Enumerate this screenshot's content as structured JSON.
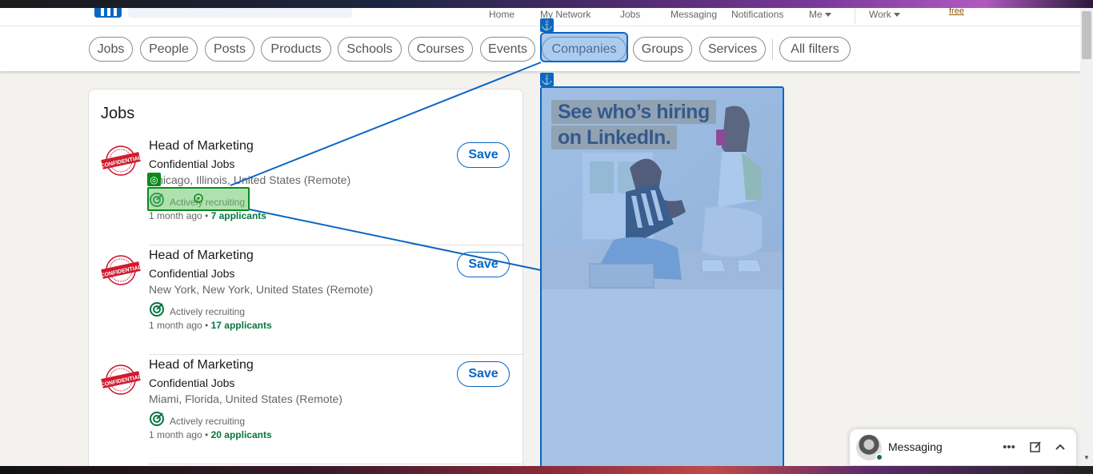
{
  "nav": {
    "items": [
      {
        "label": "Home"
      },
      {
        "label": "My Network"
      },
      {
        "label": "Jobs"
      },
      {
        "label": "Messaging"
      },
      {
        "label": "Notifications"
      },
      {
        "label": "Me"
      },
      {
        "label": "Work"
      }
    ],
    "free_label": "free"
  },
  "filters": [
    {
      "label": "Jobs"
    },
    {
      "label": "People"
    },
    {
      "label": "Posts"
    },
    {
      "label": "Products"
    },
    {
      "label": "Schools"
    },
    {
      "label": "Courses"
    },
    {
      "label": "Events"
    },
    {
      "label": "Companies"
    },
    {
      "label": "Groups"
    },
    {
      "label": "Services"
    },
    {
      "label": "All filters"
    }
  ],
  "jobs_section": {
    "title": "Jobs",
    "items": [
      {
        "title": "Head of Marketing",
        "company": "Confidential Jobs",
        "location": "Chicago, Illinois, United States (Remote)",
        "insight": "Actively recruiting",
        "posted": "1 month ago",
        "applicants": "7 applicants",
        "save_label": "Save",
        "logo_text": "CONFIDENTIAL"
      },
      {
        "title": "Head of Marketing",
        "company": "Confidential Jobs",
        "location": "New York, New York, United States (Remote)",
        "insight": "Actively recruiting",
        "posted": "1 month ago",
        "applicants": "17 applicants",
        "save_label": "Save",
        "logo_text": "CONFIDENTIAL"
      },
      {
        "title": "Head of Marketing",
        "company": "Confidential Jobs",
        "location": "Miami, Florida, United States (Remote)",
        "insight": "Actively recruiting",
        "posted": "1 month ago",
        "applicants": "20 applicants",
        "save_label": "Save",
        "logo_text": "CONFIDENTIAL"
      }
    ]
  },
  "ad": {
    "headline_line1": "See who’s hiring",
    "headline_line2": "on LinkedIn."
  },
  "messaging": {
    "label": "Messaging"
  },
  "colors": {
    "brand": "#0a66c2",
    "applicants": "#057642",
    "highlight_blue": "#4a89dc",
    "highlight_green": "#0a8a1a"
  },
  "icons": [
    "anchor-icon",
    "target-icon",
    "compose-icon",
    "more-icon",
    "chevron-up-icon",
    "caret-down-icon"
  ]
}
